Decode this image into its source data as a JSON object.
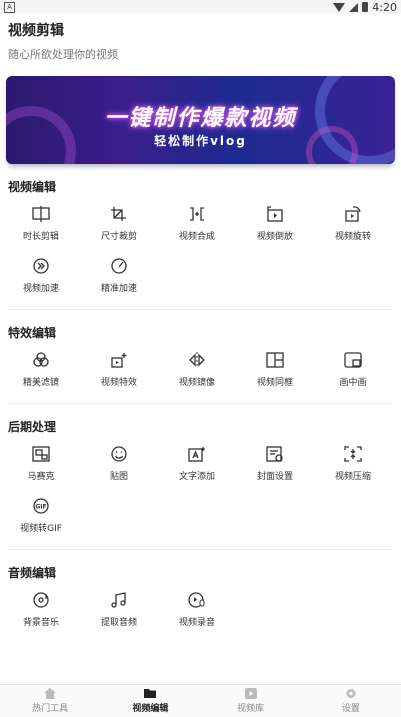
{
  "statusbar": {
    "left_glyph": "A",
    "time": "4:20"
  },
  "header": {
    "title": "视频剪辑",
    "subtitle": "随心所欲处理你的视频"
  },
  "banner": {
    "title": "一键制作爆款视频",
    "subtitle": "轻松制作vlog"
  },
  "sections": [
    {
      "title": "视频编辑",
      "items": [
        {
          "label": "时长剪辑",
          "icon": "trim-icon"
        },
        {
          "label": "尺寸裁剪",
          "icon": "crop-icon"
        },
        {
          "label": "视频合成",
          "icon": "merge-icon"
        },
        {
          "label": "视频倒放",
          "icon": "reverse-icon"
        },
        {
          "label": "视频旋转",
          "icon": "rotate-icon"
        },
        {
          "label": "视频加速",
          "icon": "speed-icon"
        },
        {
          "label": "精准加速",
          "icon": "gauge-icon"
        }
      ]
    },
    {
      "title": "特效编辑",
      "items": [
        {
          "label": "精美滤镜",
          "icon": "filter-icon"
        },
        {
          "label": "视频特效",
          "icon": "effects-icon"
        },
        {
          "label": "视频镜像",
          "icon": "mirror-icon"
        },
        {
          "label": "视频同框",
          "icon": "split-frame-icon"
        },
        {
          "label": "画中画",
          "icon": "pip-icon"
        }
      ]
    },
    {
      "title": "后期处理",
      "items": [
        {
          "label": "马赛克",
          "icon": "mosaic-icon"
        },
        {
          "label": "贴图",
          "icon": "sticker-icon"
        },
        {
          "label": "文字添加",
          "icon": "add-text-icon"
        },
        {
          "label": "封面设置",
          "icon": "cover-icon"
        },
        {
          "label": "视频压缩",
          "icon": "compress-icon"
        },
        {
          "label": "视频转GIF",
          "icon": "gif-icon"
        }
      ]
    },
    {
      "title": "音频编辑",
      "items": [
        {
          "label": "背景音乐",
          "icon": "music-disc-icon"
        },
        {
          "label": "提取音频",
          "icon": "music-note-icon"
        },
        {
          "label": "视频录音",
          "icon": "record-audio-icon"
        }
      ]
    }
  ],
  "tabbar": [
    {
      "label": "热门工具",
      "icon": "home-icon",
      "active": false
    },
    {
      "label": "视频编辑",
      "icon": "folder-icon",
      "active": true
    },
    {
      "label": "视频库",
      "icon": "video-library-icon",
      "active": false
    },
    {
      "label": "设置",
      "icon": "gear-icon",
      "active": false
    }
  ],
  "colors": {
    "banner_start": "#2a1a6e",
    "banner_end": "#3a2396",
    "active_tab": "#222222",
    "inactive_tab": "#888888"
  }
}
